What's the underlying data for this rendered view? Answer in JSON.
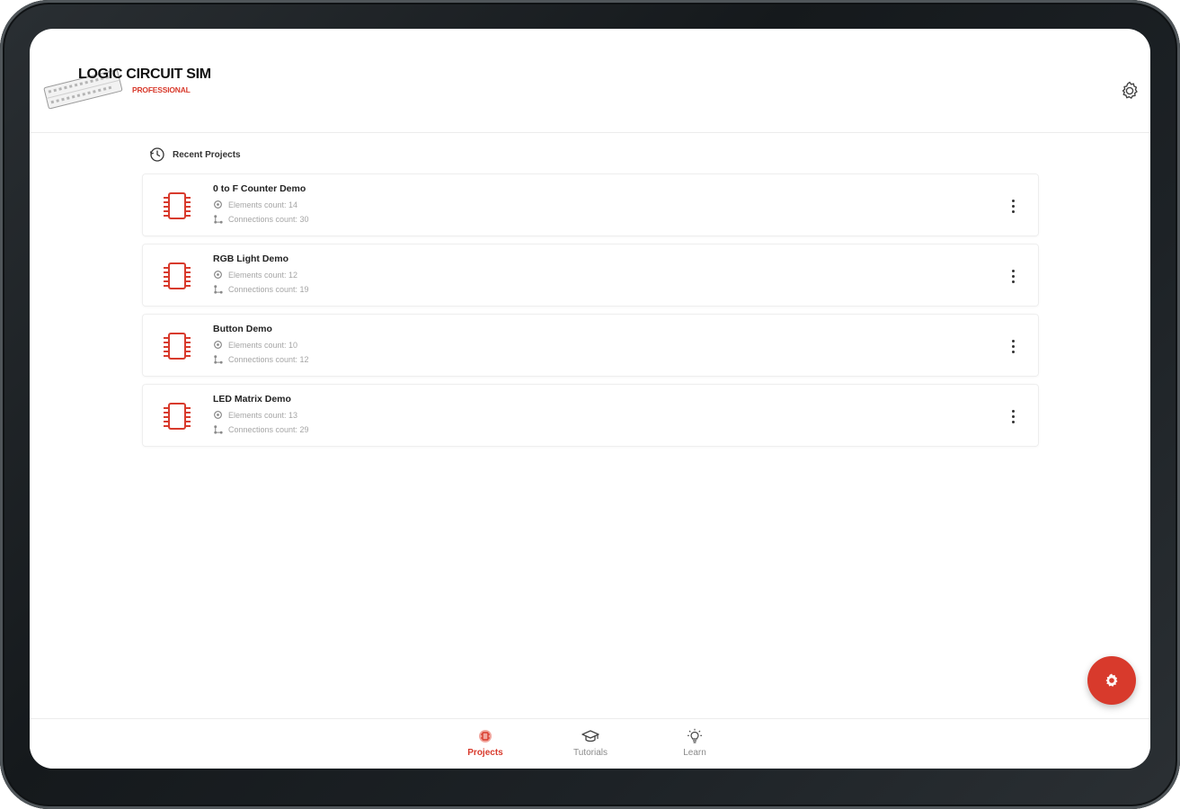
{
  "app": {
    "logo_title": "LOGIC CIRCUIT SIM",
    "logo_subtitle": "PROFESSIONAL"
  },
  "header": {
    "settings_icon": "gear-icon"
  },
  "recent": {
    "title": "Recent Projects",
    "icon": "history-icon"
  },
  "projects": [
    {
      "name": "0 to F Counter Demo",
      "elements": "Elements count: 14",
      "connections": "Connections count: 30"
    },
    {
      "name": "RGB Light Demo",
      "elements": "Elements count: 12",
      "connections": "Connections count: 19"
    },
    {
      "name": "Button Demo",
      "elements": "Elements count: 10",
      "connections": "Connections count: 12"
    },
    {
      "name": "LED Matrix Demo",
      "elements": "Elements count: 13",
      "connections": "Connections count: 29"
    }
  ],
  "fab": {
    "icon": "gear-chip-icon"
  },
  "nav": {
    "items": [
      {
        "label": "Projects",
        "icon": "chip-icon",
        "active": true
      },
      {
        "label": "Tutorials",
        "icon": "graduation-cap-icon",
        "active": false
      },
      {
        "label": "Learn",
        "icon": "lightbulb-icon",
        "active": false
      }
    ]
  },
  "colors": {
    "accent": "#d83a2c",
    "text": "#222222",
    "muted": "#a6a6a6"
  }
}
